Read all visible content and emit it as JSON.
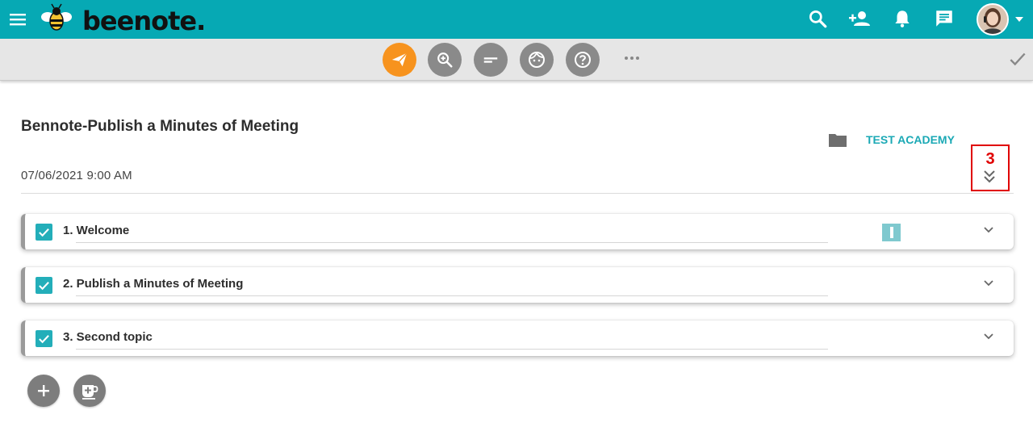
{
  "app": {
    "logo_text": "beenote",
    "logo_dot": "."
  },
  "topbar": {
    "icons": [
      "menu-icon",
      "search-icon",
      "add-user-icon",
      "bell-icon",
      "chat-icon",
      "avatar",
      "caret-down-icon"
    ],
    "color": "#06a9b4"
  },
  "toolbar": {
    "buttons": [
      "send-icon",
      "zoom-in-icon",
      "notes-icon",
      "face-icon",
      "help-icon",
      "more-icon",
      "check-icon"
    ],
    "accent": "#f7931e"
  },
  "meeting": {
    "title": "Bennote-Publish a Minutes of Meeting",
    "datetime": "07/06/2021 9:00 AM",
    "folder": "TEST ACADEMY",
    "marker_number": "3"
  },
  "topics": [
    {
      "label": "1. Welcome",
      "checked": true,
      "has_badge": true
    },
    {
      "label": "2. Publish a Minutes of Meeting",
      "checked": true,
      "has_badge": false
    },
    {
      "label": "3. Second topic",
      "checked": true,
      "has_badge": false
    }
  ],
  "bottom_buttons": [
    "add-topic-icon",
    "add-break-icon"
  ]
}
